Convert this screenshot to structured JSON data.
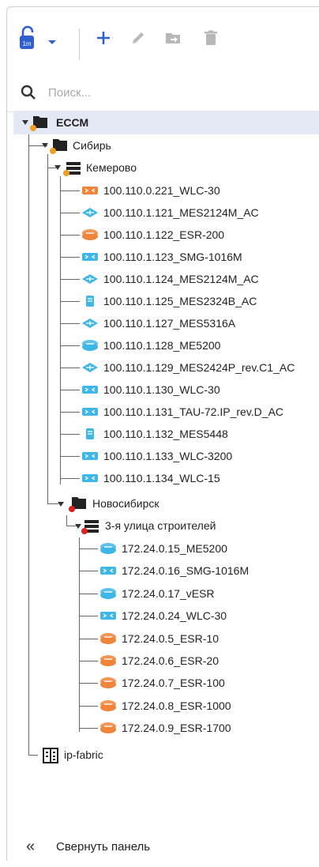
{
  "search": {
    "placeholder": "Поиск..."
  },
  "tree": {
    "root": {
      "label": "ECCM"
    },
    "region": {
      "label": "Сибирь"
    },
    "kemerovo": {
      "label": "Кемерово",
      "devices": [
        {
          "label": "100.110.0.221_WLC-30",
          "kind": "access-point",
          "color": "#f0843a"
        },
        {
          "label": "100.110.1.121_MES2124M_AC",
          "kind": "switch",
          "color": "#3fb6e8"
        },
        {
          "label": "100.110.1.122_ESR-200",
          "kind": "router",
          "color": "#f0843a"
        },
        {
          "label": "100.110.1.123_SMG-1016M",
          "kind": "gateway",
          "color": "#3fb6e8"
        },
        {
          "label": "100.110.1.124_MES2124M_AC",
          "kind": "switch",
          "color": "#3fb6e8"
        },
        {
          "label": "100.110.1.125_MES2324B_AC",
          "kind": "module",
          "color": "#3fb6e8"
        },
        {
          "label": "100.110.1.127_MES5316A",
          "kind": "switch",
          "color": "#3fb6e8"
        },
        {
          "label": "100.110.1.128_ME5200",
          "kind": "router",
          "color": "#3fb6e8"
        },
        {
          "label": "100.110.1.129_MES2424P_rev.C1_AC",
          "kind": "switch",
          "color": "#3fb6e8"
        },
        {
          "label": "100.110.1.130_WLC-30",
          "kind": "access-point",
          "color": "#3fb6e8"
        },
        {
          "label": "100.110.1.131_TAU-72.IP_rev.D_AC",
          "kind": "gateway",
          "color": "#3fb6e8"
        },
        {
          "label": "100.110.1.132_MES5448",
          "kind": "module",
          "color": "#3fb6e8"
        },
        {
          "label": "100.110.1.133_WLC-3200",
          "kind": "access-point",
          "color": "#3fb6e8"
        },
        {
          "label": "100.110.1.134_WLC-15",
          "kind": "access-point",
          "color": "#3fb6e8"
        }
      ]
    },
    "novosibirsk": {
      "label": "Новосибирск"
    },
    "street": {
      "label": "3-я улица строителей",
      "devices": [
        {
          "label": "172.24.0.15_ME5200",
          "kind": "router",
          "color": "#3fb6e8"
        },
        {
          "label": "172.24.0.16_SMG-1016M",
          "kind": "gateway",
          "color": "#3fb6e8"
        },
        {
          "label": "172.24.0.17_vESR",
          "kind": "router",
          "color": "#3fb6e8"
        },
        {
          "label": "172.24.0.24_WLC-30",
          "kind": "access-point",
          "color": "#3fb6e8"
        },
        {
          "label": "172.24.0.5_ESR-10",
          "kind": "router",
          "color": "#f0843a"
        },
        {
          "label": "172.24.0.6_ESR-20",
          "kind": "router",
          "color": "#f0843a"
        },
        {
          "label": "172.24.0.7_ESR-100",
          "kind": "router",
          "color": "#f0843a"
        },
        {
          "label": "172.24.0.8_ESR-1000",
          "kind": "router",
          "color": "#f0843a"
        },
        {
          "label": "172.24.0.9_ESR-1700",
          "kind": "router",
          "color": "#f0843a"
        }
      ]
    },
    "ipfabric": {
      "label": "ip-fabric"
    }
  },
  "footer": {
    "collapse_label": "Свернуть панель",
    "chevron": "«"
  },
  "colors": {
    "accent": "#2f5fd0",
    "warning": "#f0a020",
    "error": "#e02020",
    "disabled": "#b8b8b8"
  }
}
